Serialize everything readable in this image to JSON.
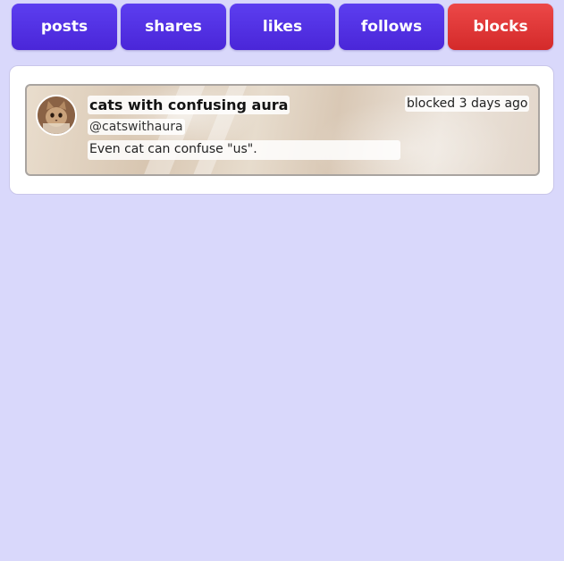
{
  "tabs": [
    {
      "label": "posts",
      "active": false
    },
    {
      "label": "shares",
      "active": false
    },
    {
      "label": "likes",
      "active": false
    },
    {
      "label": "follows",
      "active": false
    },
    {
      "label": "blocks",
      "active": true
    }
  ],
  "blocked_user": {
    "display_name": "cats with confusing aura",
    "handle": "@catswithaura",
    "bio": "Even cat can confuse \"us\".",
    "status": "blocked 3 days ago",
    "avatar_icon": "cat-avatar-icon"
  },
  "colors": {
    "background": "#d9d8fb",
    "tab_normal": "#5232e3",
    "tab_active": "#e03838",
    "panel": "#ffffff"
  }
}
